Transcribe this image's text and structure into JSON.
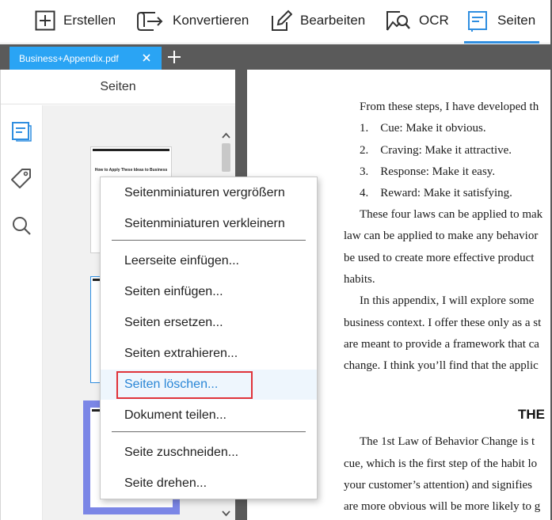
{
  "toolbar": {
    "items": [
      {
        "label": "Erstellen",
        "icon": "plus-box-icon"
      },
      {
        "label": "Konvertieren",
        "icon": "convert-icon"
      },
      {
        "label": "Bearbeiten",
        "icon": "edit-icon"
      },
      {
        "label": "OCR",
        "icon": "ocr-icon"
      },
      {
        "label": "Seiten",
        "icon": "pages-icon",
        "active": true
      }
    ]
  },
  "tabs": {
    "document_tab": "Business+Appendix.pdf",
    "close_icon": "close-icon",
    "new_tab_icon": "plus-icon"
  },
  "panel": {
    "title": "Seiten",
    "side_icons": [
      "pages-icon",
      "tag-icon",
      "search-icon"
    ],
    "thumbnail_title": "How to Apply These Ideas to Business"
  },
  "context_menu": {
    "items": [
      "Seitenminiaturen vergrößern",
      "Seitenminiaturen verkleinern",
      "Leerseite einfügen...",
      "Seiten einfügen...",
      "Seiten ersetzen...",
      "Seiten extrahieren...",
      "Seiten löschen...",
      "Dokument teilen...",
      "Seite zuschneiden...",
      "Seite drehen..."
    ],
    "highlighted": "Seiten löschen..."
  },
  "document": {
    "lines": [
      "From these steps, I have developed th",
      "1.    Cue: Make it obvious.",
      "2.    Craving: Make it attractive.",
      "3.    Response: Make it easy.",
      "4.    Reward: Make it satisfying.",
      "These four laws can be applied to mak",
      "law can be applied to make any behavior",
      "be used to create more effective product",
      "habits.",
      "In this appendix, I will explore some",
      "business context. I offer these only as a st",
      "are meant to provide a framework that ca",
      "change. I think you’ll find that the applic",
      "The 1st Law of Behavior Change is t",
      "cue, which is the first step of the habit lo",
      "your customer’s attention) and signifies",
      "are more obvious will be more likely to g"
    ],
    "heading": "THE"
  },
  "colors": {
    "accent": "#2f8ee0",
    "tab_blue": "#2aa4f4",
    "highlight_red": "#e0333a",
    "chrome_gray": "#5a5a5a"
  }
}
